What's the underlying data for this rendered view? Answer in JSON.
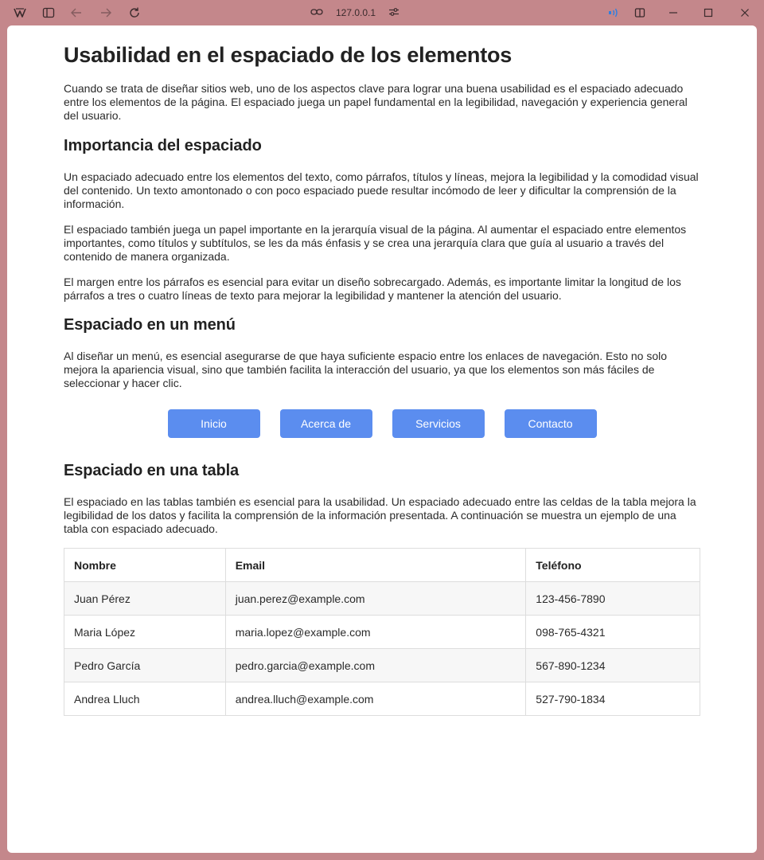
{
  "browser": {
    "address": "127.0.0.1"
  },
  "page": {
    "title": "Usabilidad en el espaciado de los elementos",
    "intro": "Cuando se trata de diseñar sitios web, uno de los aspectos clave para lograr una buena usabilidad es el espaciado adecuado entre los elementos de la página. El espaciado juega un papel fundamental en la legibilidad, navegación y experiencia general del usuario.",
    "importancia": {
      "heading": "Importancia del espaciado",
      "p1": "Un espaciado adecuado entre los elementos del texto, como párrafos, títulos y líneas, mejora la legibilidad y la comodidad visual del contenido. Un texto amontonado o con poco espaciado puede resultar incómodo de leer y dificultar la comprensión de la información.",
      "p2": "El espaciado también juega un papel importante en la jerarquía visual de la página. Al aumentar el espaciado entre elementos importantes, como títulos y subtítulos, se les da más énfasis y se crea una jerarquía clara que guía al usuario a través del contenido de manera organizada.",
      "p3": "El margen entre los párrafos es esencial para evitar un diseño sobrecargado. Además, es importante limitar la longitud de los párrafos a tres o cuatro líneas de texto para mejorar la legibilidad y mantener la atención del usuario."
    },
    "menu": {
      "heading": "Espaciado en un menú",
      "text": "Al diseñar un menú, es esencial asegurarse de que haya suficiente espacio entre los enlaces de navegación. Esto no solo mejora la apariencia visual, sino que también facilita la interacción del usuario, ya que los elementos son más fáciles de seleccionar y hacer clic.",
      "buttons": [
        "Inicio",
        "Acerca de",
        "Servicios",
        "Contacto"
      ],
      "button_color": "#5b8def"
    },
    "tabla": {
      "heading": "Espaciado en una tabla",
      "text": "El espaciado en las tablas también es esencial para la usabilidad. Un espaciado adecuado entre las celdas de la tabla mejora la legibilidad de los datos y facilita la comprensión de la información presentada. A continuación se muestra un ejemplo de una tabla con espaciado adecuado.",
      "headers": [
        "Nombre",
        "Email",
        "Teléfono"
      ],
      "rows": [
        [
          "Juan Pérez",
          "juan.perez@example.com",
          "123-456-7890"
        ],
        [
          "Maria López",
          "maria.lopez@example.com",
          "098-765-4321"
        ],
        [
          "Pedro García",
          "pedro.garcia@example.com",
          "567-890-1234"
        ],
        [
          "Andrea Lluch",
          "andrea.lluch@example.com",
          "527-790-1834"
        ]
      ]
    }
  },
  "colors": {
    "window_frame": "#c4878b",
    "stripe": "#f7f7f7",
    "border": "#dddddd"
  },
  "icons": [
    "app-logo-icon",
    "sidebar-toggle-icon",
    "back-arrow-icon",
    "forward-arrow-icon",
    "reload-icon",
    "link-icon",
    "site-settings-icon",
    "audio-playing-icon",
    "split-view-icon",
    "minimize-icon",
    "maximize-icon",
    "close-icon"
  ]
}
